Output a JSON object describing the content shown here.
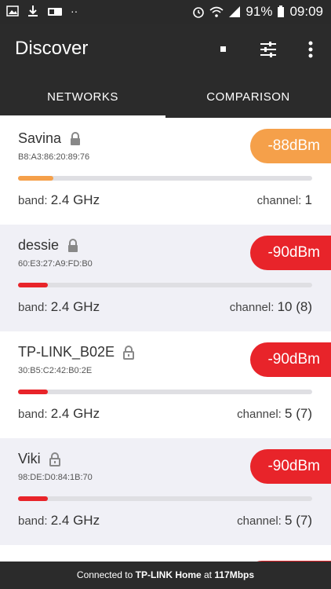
{
  "status_bar": {
    "battery": "91%",
    "time": "09:09"
  },
  "app_bar": {
    "title": "Discover",
    "tabs": [
      {
        "label": "NETWORKS",
        "active": true
      },
      {
        "label": "COMPARISON",
        "active": false
      }
    ]
  },
  "networks": [
    {
      "ssid": "Savina",
      "mac": "B8:A3:86:20:89:76",
      "signal": "-88dBm",
      "signal_color": "#f5a04a",
      "strength_fraction": 0.12,
      "band_label": "band:",
      "band": "2.4 GHz",
      "channel_label": "channel:",
      "channel": "1",
      "bg": "light"
    },
    {
      "ssid": "dessie",
      "mac": "60:E3:27:A9:FD:B0",
      "signal": "-90dBm",
      "signal_color": "#e8242a",
      "strength_fraction": 0.1,
      "band_label": "band:",
      "band": "2.4 GHz",
      "channel_label": "channel:",
      "channel": "10 (8)",
      "bg": "tint"
    },
    {
      "ssid": "TP-LINK_B02E",
      "mac": "30:B5:C2:42:B0:2E",
      "signal": "-90dBm",
      "signal_color": "#e8242a",
      "strength_fraction": 0.1,
      "band_label": "band:",
      "band": "2.4 GHz",
      "channel_label": "channel:",
      "channel": "5 (7)",
      "bg": "light"
    },
    {
      "ssid": "Viki",
      "mac": "98:DE:D0:84:1B:70",
      "signal": "-90dBm",
      "signal_color": "#e8242a",
      "strength_fraction": 0.1,
      "band_label": "band:",
      "band": "2.4 GHz",
      "channel_label": "channel:",
      "channel": "5 (7)",
      "bg": "tint"
    }
  ],
  "footer": {
    "prefix": "Connected to",
    "network": "TP-LINK Home",
    "middle": "at",
    "speed": "117Mbps"
  },
  "colors": {
    "app_bar": "#2b2b2b",
    "orange": "#f5a04a",
    "red": "#e8242a"
  }
}
